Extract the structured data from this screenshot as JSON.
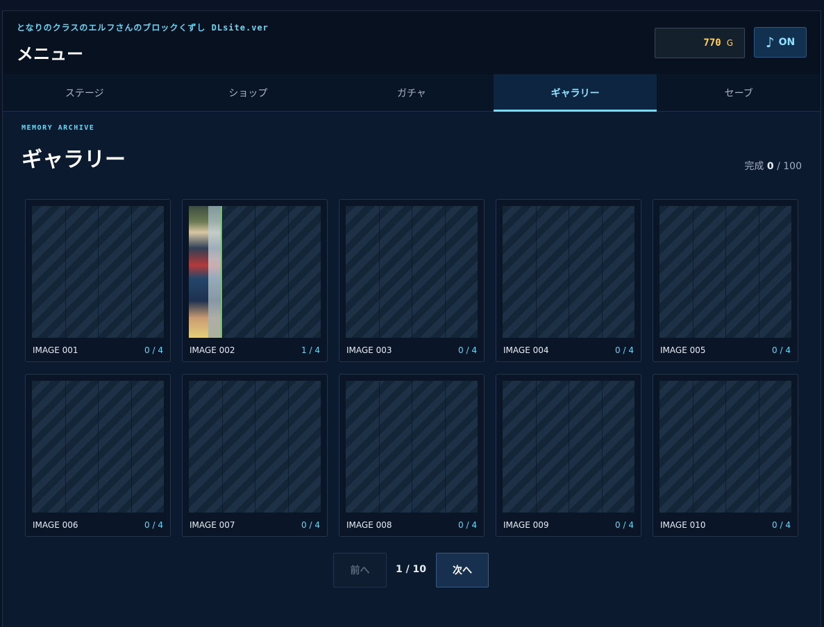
{
  "header": {
    "game_title": "となりのクラスのエルフさんのブロックくずし DLsite.ver",
    "menu_title": "メニュー",
    "gold_amount": "770",
    "gold_unit": "G",
    "sound_icon": "music-note-icon",
    "sound_label": "ON"
  },
  "tabs": [
    {
      "label": "ステージ",
      "active": false
    },
    {
      "label": "ショップ",
      "active": false
    },
    {
      "label": "ガチャ",
      "active": false
    },
    {
      "label": "ギャラリー",
      "active": true
    },
    {
      "label": "セーブ",
      "active": false
    }
  ],
  "gallery": {
    "subtitle": "MEMORY ARCHIVE",
    "title": "ギャラリー",
    "completion_label": "完成",
    "completion_count": "0",
    "completion_sep": "/",
    "completion_total": "100",
    "items": [
      {
        "label": "IMAGE 001",
        "count": "0 / 4",
        "unlocked_pieces": 0
      },
      {
        "label": "IMAGE 002",
        "count": "1 / 4",
        "unlocked_pieces": 1
      },
      {
        "label": "IMAGE 003",
        "count": "0 / 4",
        "unlocked_pieces": 0
      },
      {
        "label": "IMAGE 004",
        "count": "0 / 4",
        "unlocked_pieces": 0
      },
      {
        "label": "IMAGE 005",
        "count": "0 / 4",
        "unlocked_pieces": 0
      },
      {
        "label": "IMAGE 006",
        "count": "0 / 4",
        "unlocked_pieces": 0
      },
      {
        "label": "IMAGE 007",
        "count": "0 / 4",
        "unlocked_pieces": 0
      },
      {
        "label": "IMAGE 008",
        "count": "0 / 4",
        "unlocked_pieces": 0
      },
      {
        "label": "IMAGE 009",
        "count": "0 / 4",
        "unlocked_pieces": 0
      },
      {
        "label": "IMAGE 010",
        "count": "0 / 4",
        "unlocked_pieces": 0
      }
    ]
  },
  "pager": {
    "prev_label": "前へ",
    "page_info": "1 / 10",
    "next_label": "次へ"
  }
}
